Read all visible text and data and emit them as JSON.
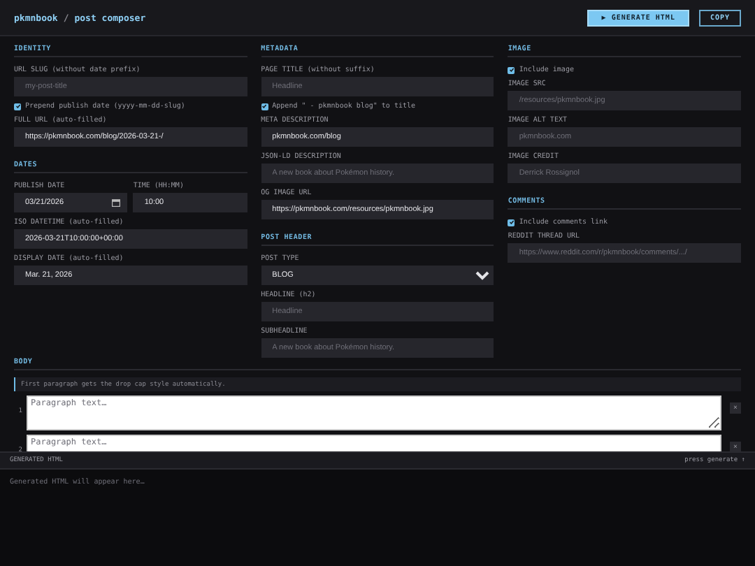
{
  "header": {
    "brand": "pkmnbook",
    "separator": "/",
    "title": "post composer",
    "buttons": [
      {
        "label": "▶ GENERATE HTML",
        "primary": true
      },
      {
        "label": "COPY",
        "primary": false
      }
    ]
  },
  "columns": [
    {
      "sections": [
        {
          "title": "IDENTITY",
          "fields": [
            {
              "kind": "text",
              "label": "URL SLUG (without date prefix)",
              "placeholder": "my-post-title"
            },
            {
              "kind": "checkbox",
              "label": "Prepend publish date (yyyy-mm-dd-slug)",
              "checked": true
            },
            {
              "kind": "text",
              "label": "FULL URL (auto-filled)",
              "value": "https://pkmnbook.com/blog/2026-03-21-/"
            }
          ]
        },
        {
          "title": "DATES",
          "fields": [
            {
              "kind": "row",
              "fields": [
                {
                  "kind": "date",
                  "label": "PUBLISH DATE",
                  "value": "03/21/2026"
                },
                {
                  "kind": "text",
                  "label": "TIME (HH:MM)",
                  "value": "10:00"
                }
              ]
            },
            {
              "kind": "text",
              "label": "ISO DATETIME (auto-filled)",
              "value": "2026-03-21T10:00:00+00:00"
            },
            {
              "kind": "text",
              "label": "DISPLAY DATE (auto-filled)",
              "value": "Mar. 21, 2026"
            }
          ]
        }
      ]
    },
    {
      "sections": [
        {
          "title": "METADATA",
          "fields": [
            {
              "kind": "text",
              "label": "PAGE TITLE (without suffix)",
              "placeholder": "Headline"
            },
            {
              "kind": "checkbox",
              "label": "Append \" - pkmnbook blog\" to title",
              "checked": true
            },
            {
              "kind": "text",
              "label": "META DESCRIPTION",
              "value": "pkmnbook.com/blog"
            },
            {
              "kind": "text",
              "label": "JSON-LD DESCRIPTION",
              "placeholder": "A new book about Pokémon history."
            },
            {
              "kind": "text",
              "label": "OG IMAGE URL",
              "value": "https://pkmnbook.com/resources/pkmnbook.jpg"
            }
          ]
        },
        {
          "title": "POST HEADER",
          "fields": [
            {
              "kind": "select",
              "label": "POST TYPE",
              "value": "BLOG"
            },
            {
              "kind": "text",
              "label": "HEADLINE (h2)",
              "placeholder": "Headline"
            },
            {
              "kind": "text",
              "label": "SUBHEADLINE",
              "placeholder": "A new book about Pokémon history."
            }
          ]
        }
      ]
    },
    {
      "sections": [
        {
          "title": "IMAGE",
          "fields": [
            {
              "kind": "checkbox",
              "label": "Include image",
              "checked": true
            },
            {
              "kind": "text",
              "label": "IMAGE SRC",
              "placeholder": "/resources/pkmnbook.jpg"
            },
            {
              "kind": "text",
              "label": "IMAGE ALT TEXT",
              "placeholder": "pkmnbook.com"
            },
            {
              "kind": "text",
              "label": "IMAGE CREDIT",
              "placeholder": "Derrick Rossignol"
            }
          ]
        },
        {
          "title": "COMMENTS",
          "fields": [
            {
              "kind": "checkbox",
              "label": "Include comments link",
              "checked": true
            },
            {
              "kind": "text",
              "label": "REDDIT THREAD URL",
              "placeholder": "https://www.reddit.com/r/pkmnbook/comments/.../"
            }
          ]
        }
      ]
    }
  ],
  "body": {
    "title": "BODY",
    "hint": "First paragraph gets the drop cap style automatically.",
    "paragraphs": [
      {
        "number": "1",
        "placeholder": "Paragraph text…",
        "remove": "×"
      },
      {
        "number": "2",
        "placeholder": "Paragraph text…",
        "remove": "×"
      }
    ]
  },
  "output": {
    "title": "GENERATED HTML",
    "status": "press generate ↑",
    "placeholder": "Generated HTML will appear here…"
  }
}
